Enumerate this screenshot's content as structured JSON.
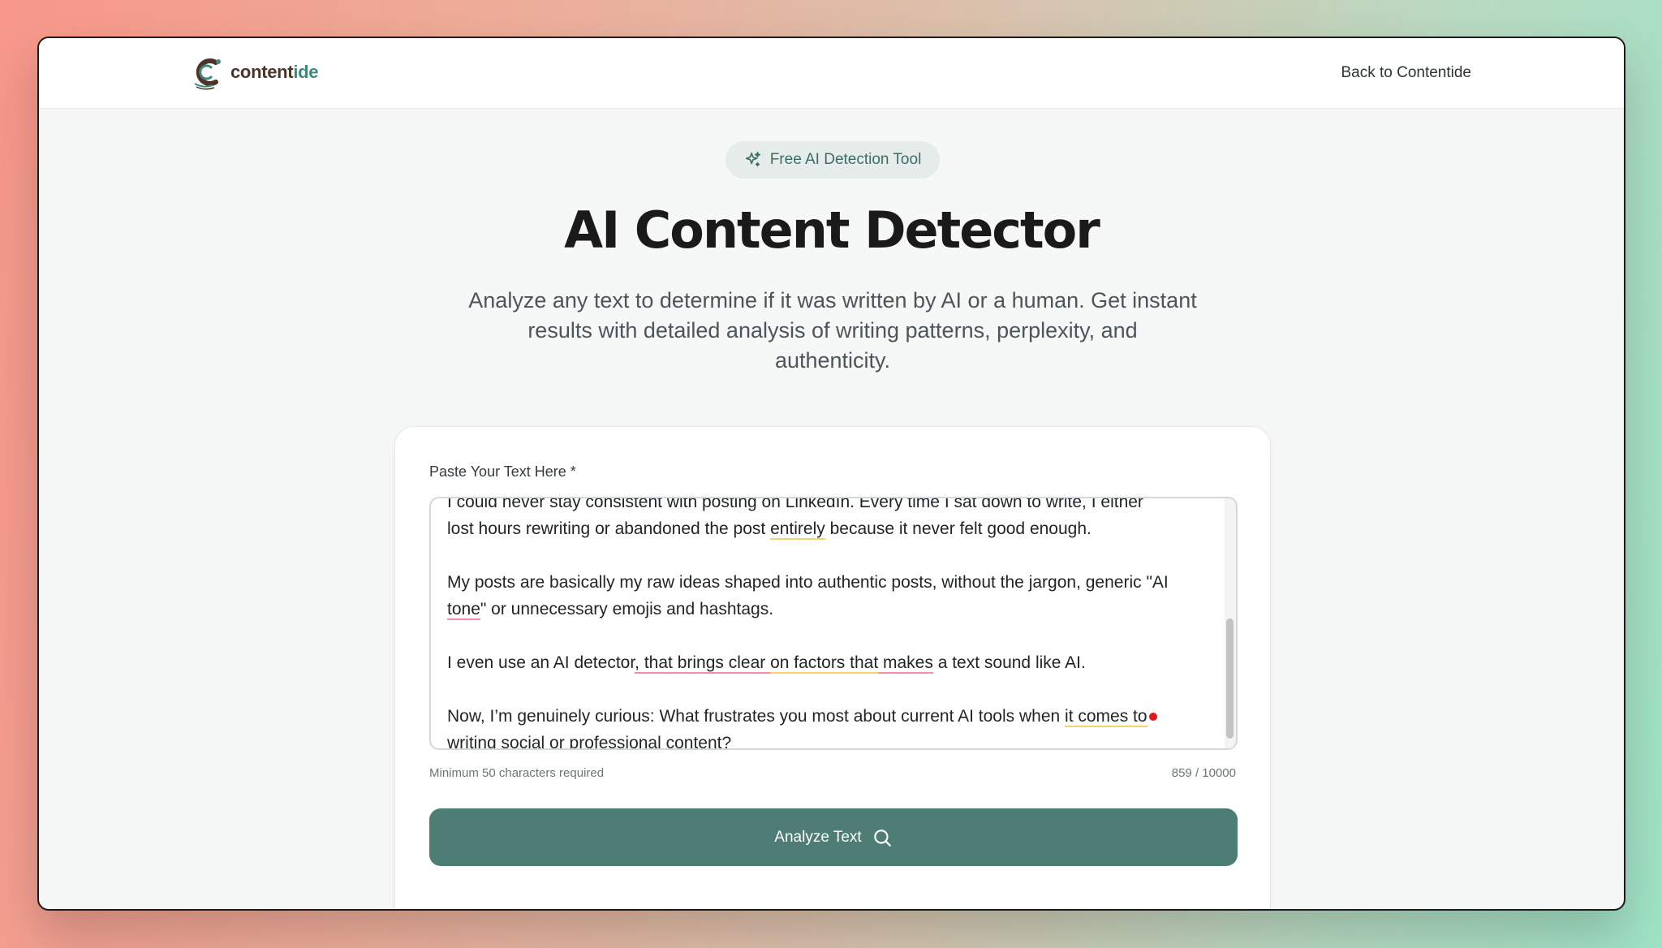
{
  "header": {
    "logo_text_a": "content",
    "logo_text_b": "ide",
    "back_link": "Back to Contentide"
  },
  "hero": {
    "badge": "Free AI Detection Tool",
    "title": "AI Content Detector",
    "subtitle": "Analyze any text to determine if it was written by AI or a human. Get instant results with detailed analysis of writing patterns, perplexity, and authenticity."
  },
  "form": {
    "label": "Paste Your Text Here *",
    "text": {
      "p1_hidden": "I could never stay consistent with posting on LinkedIn. Every time I sat down to write, I either",
      "p1_a": "lost hours rewriting or abandoned the post ",
      "p1_u1": "entirely",
      "p1_b": " because it never felt good enough.",
      "p2_a": "My posts are basically my raw ideas shaped into authentic posts, without the jargon, generic \"AI ",
      "p2_u1": "tone",
      "p2_b": "\" or unnecessary emojis and hashtags.",
      "p3_a": "I even use an AI detector",
      "p3_u1": ", that brings",
      "p3_u2": " clear ",
      "p3_u3": "on factors that",
      "p3_u4": " makes",
      "p3_b": " a text sound like AI.",
      "p4_a": "Now, I’m genuinely curious: What frustrates you most about current AI tools when ",
      "p4_u1": "it comes to",
      "p4_b": " writing social or professional content?"
    },
    "hint": "Minimum 50 characters required",
    "counter": "859 / 10000",
    "button_label": "Analyze Text"
  },
  "colors": {
    "accent": "#4e7d76",
    "badge_bg": "#e6ecea",
    "underline_yellow": "#f4d36b",
    "underline_pink": "#ef8fa9"
  },
  "icons": {
    "badge": "sparkles-icon",
    "button": "search-icon",
    "logo": "contentide-logo"
  }
}
